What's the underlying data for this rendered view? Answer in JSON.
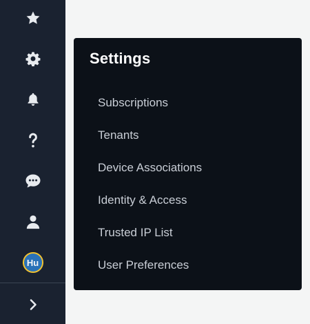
{
  "sidebar": {
    "icons": [
      {
        "name": "star-icon"
      },
      {
        "name": "gear-icon"
      },
      {
        "name": "bell-icon"
      },
      {
        "name": "help-icon"
      },
      {
        "name": "chat-icon"
      },
      {
        "name": "user-icon"
      }
    ],
    "avatar_initials": "Hu",
    "avatar_ring_color": "#f2c230",
    "expand_icon": "chevron-right-icon"
  },
  "panel": {
    "title": "Settings",
    "items": [
      {
        "label": "Subscriptions"
      },
      {
        "label": "Tenants"
      },
      {
        "label": "Device Associations"
      },
      {
        "label": "Identity & Access"
      },
      {
        "label": "Trusted IP List"
      },
      {
        "label": "User Preferences"
      }
    ]
  },
  "colors": {
    "sidebar_bg": "#1a2230",
    "panel_bg": "#0c1118",
    "page_bg": "#f4f5f5",
    "icon_color": "#e8ebef"
  }
}
